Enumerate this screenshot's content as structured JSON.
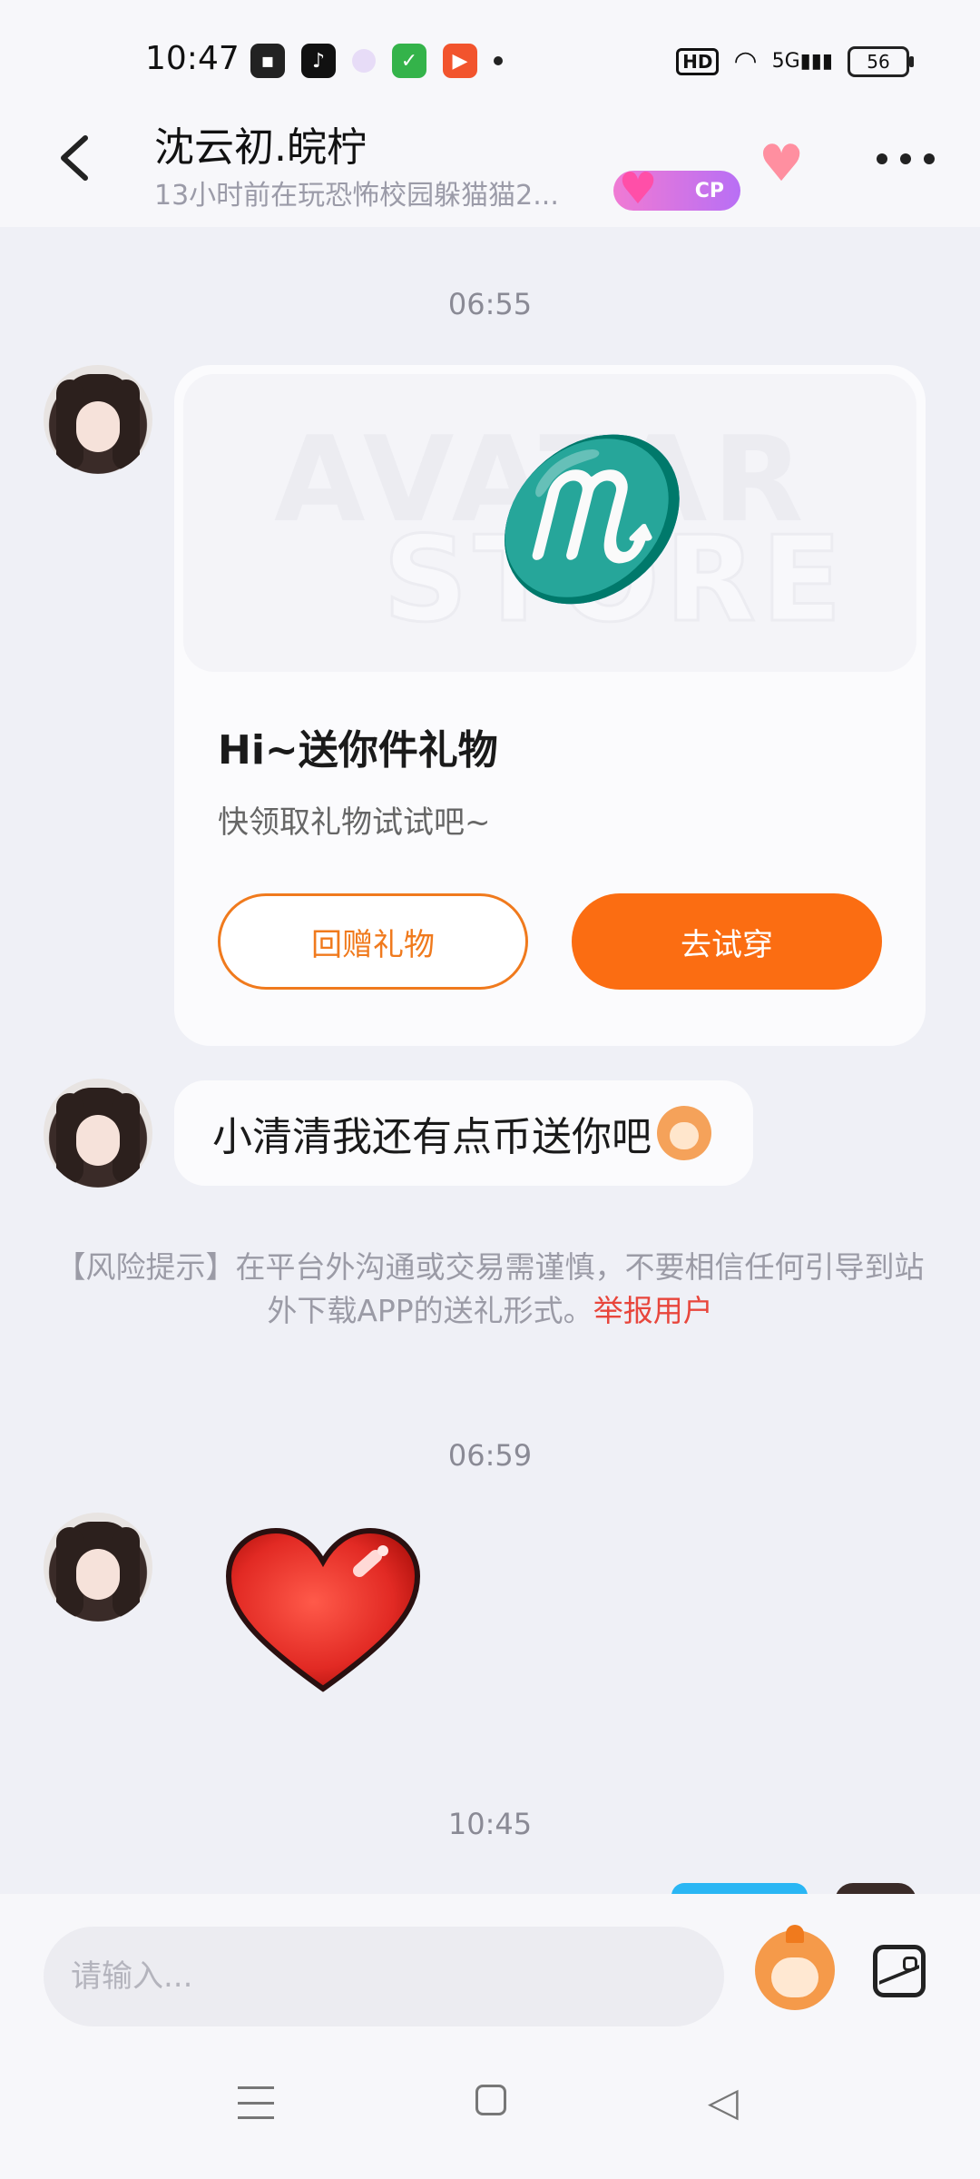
{
  "status_bar": {
    "time": "10:47",
    "network": "5G",
    "hd": "HD",
    "battery": "56"
  },
  "header": {
    "back_icon": "chevron-left-icon",
    "contact_name": "沈云初.皖柠",
    "contact_status": "13小时前在玩恐怖校园躲猫猫2...",
    "cp_label": "CP",
    "more_icon": "more-dots-icon"
  },
  "chat": {
    "timestamps": [
      "06:55",
      "06:59",
      "10:45"
    ],
    "gift_card": {
      "title": "Hi~送你件礼物",
      "subtitle": "快领取礼物试试吧~",
      "return_gift_label": "回赠礼物",
      "try_on_label": "去试穿",
      "watermark_line1": "AVATAR",
      "watermark_line2": "STORE",
      "zodiac_symbol": "♏"
    },
    "message_text": "小清清我还有点币送你吧",
    "risk_notice": "【风险提示】在平台外沟通或交易需谨慎，不要相信任何引导到站外下载APP的送礼形式。",
    "report_link": "举报用户"
  },
  "input_bar": {
    "placeholder": "请输入..."
  },
  "colors": {
    "accent_orange": "#fb6d12",
    "report_red": "#e8463c",
    "sent_blue": "#2ab6f4"
  }
}
